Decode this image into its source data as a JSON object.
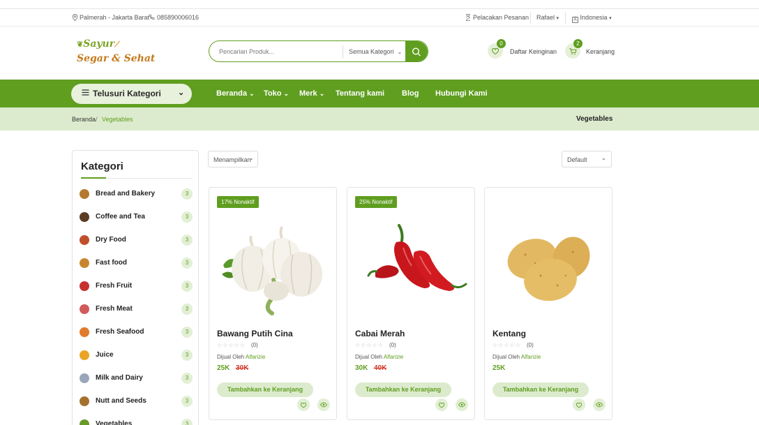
{
  "topbar": {
    "location": "Palmerah - Jakarta Barat",
    "phone": "085890006016",
    "track_order": "Pelacakan Pesanan",
    "user": "Rafael",
    "language": "Indonesia"
  },
  "header": {
    "logo_line1": "Sayur",
    "logo_line2": "Segar & Sehat",
    "search_placeholder": "Pencarian Produk...",
    "search_category": "Semua Kategori",
    "wishlist_label": "Daftar Keinginan",
    "wishlist_count": "0",
    "cart_label": "Keranjang",
    "cart_count": "2"
  },
  "nav": {
    "browse_label": "Telusuri Kategori",
    "links": [
      "Beranda",
      "Toko",
      "Merk",
      "Tentang kami",
      "Blog",
      "Hubungi Kami"
    ]
  },
  "breadcrumb": {
    "home": "Beranda",
    "separator": "/",
    "current": "Vegetables",
    "page_title": "Vegetables"
  },
  "sidebar": {
    "title": "Kategori",
    "categories": [
      {
        "label": "Bread and Bakery",
        "count": "3",
        "icon": "bread-icon"
      },
      {
        "label": "Coffee and Tea",
        "count": "3",
        "icon": "coffee-icon"
      },
      {
        "label": "Dry Food",
        "count": "3",
        "icon": "dry-food-icon"
      },
      {
        "label": "Fast food",
        "count": "3",
        "icon": "burger-icon"
      },
      {
        "label": "Fresh Fruit",
        "count": "3",
        "icon": "fruit-icon"
      },
      {
        "label": "Fresh Meat",
        "count": "3",
        "icon": "meat-icon"
      },
      {
        "label": "Fresh Seafood",
        "count": "3",
        "icon": "seafood-icon"
      },
      {
        "label": "Juice",
        "count": "3",
        "icon": "juice-icon"
      },
      {
        "label": "Milk and Dairy",
        "count": "3",
        "icon": "milk-icon"
      },
      {
        "label": "Nutt and Seeds",
        "count": "3",
        "icon": "nuts-icon"
      },
      {
        "label": "Vegetables",
        "count": "3",
        "icon": "vegetables-icon"
      }
    ]
  },
  "toolbar": {
    "show_label": "Menampilkan",
    "sort_value": "Default"
  },
  "products": [
    {
      "discount": "17% Nonaktif",
      "name": "Bawang Putih Cina",
      "rating": "(0)",
      "sold_by": "Dijual Oleh",
      "seller": "Alfarizie",
      "price": "25K",
      "old_price": "30K",
      "add_label": "Tambahkan ke Keranjang",
      "image": "garlic-image"
    },
    {
      "discount": "25% Nonaktif",
      "name": "Cabai Merah",
      "rating": "(0)",
      "sold_by": "Dijual Oleh",
      "seller": "Alfarizie",
      "price": "30K",
      "old_price": "40K",
      "add_label": "Tambahkan ke Keranjang",
      "image": "chili-image"
    },
    {
      "discount": "",
      "name": "Kentang",
      "rating": "(0)",
      "sold_by": "Dijual Oleh",
      "seller": "Alfarizie",
      "price": "25K",
      "old_price": "",
      "add_label": "Tambahkan ke Keranjang",
      "image": "potato-image"
    }
  ],
  "colors": {
    "brand_green": "#5f9e1f",
    "light_green": "#dcebcd",
    "sale_red": "#d23b2a"
  }
}
